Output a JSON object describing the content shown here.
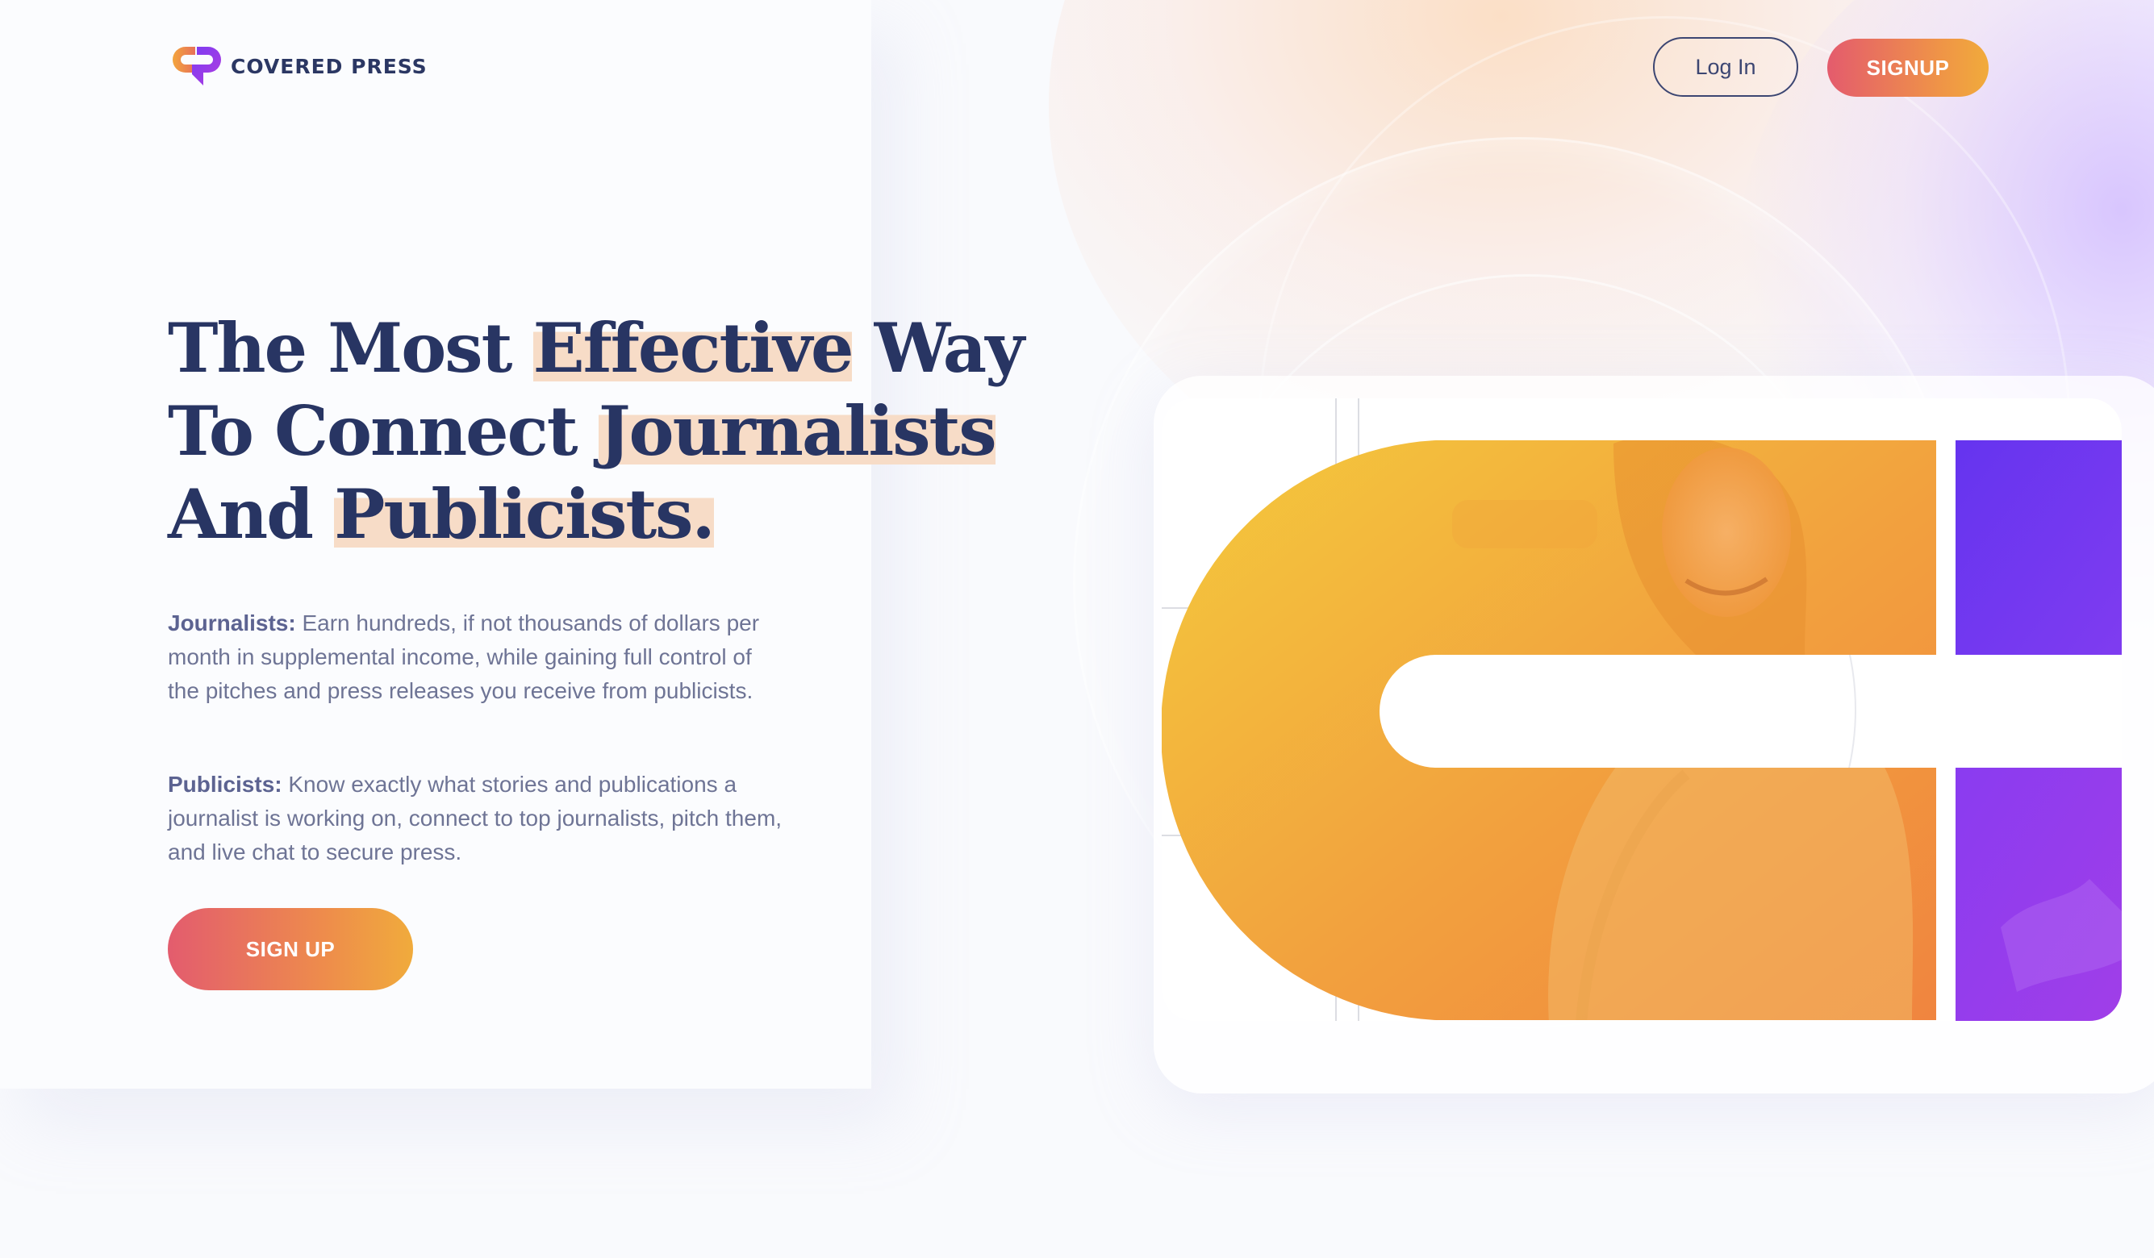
{
  "brand": {
    "name": "COVERED PRESS",
    "logo_icon": "covered-press-logo-icon"
  },
  "nav": {
    "login_label": "Log In",
    "signup_label": "SIGNUP"
  },
  "hero": {
    "headline_lines": [
      {
        "plain": "The Most ",
        "highlight": "Effective",
        "tail": " Way"
      },
      {
        "plain": "To Connect ",
        "highlight": "Journalists",
        "tail": ""
      },
      {
        "plain": "And ",
        "highlight": "Publicists.",
        "tail": ""
      }
    ],
    "journalists_label": "Journalists:",
    "journalists_text": " Earn hundreds, if not thousands of dollars per month in supplemental income, while gaining full control of the pitches and press releases you receive from publicists.",
    "publicists_label": "Publicists:",
    "publicists_text": " Know exactly what stories and publications a journalist is working on, connect to top journalists, pitch them, and live chat to secure press.",
    "cta_label": "SIGN UP"
  },
  "illustration": {
    "icon": "covered-press-c-photo-illustration",
    "colors": {
      "orange_start": "#f2c63a",
      "orange_end": "#f08a3a",
      "purple_start": "#6a36f0",
      "purple_end": "#9b3cf0"
    }
  },
  "colors": {
    "navy": "#283563",
    "highlight": "#f7dcc7",
    "gradient_start": "#e35c6e",
    "gradient_end": "#f0ab3c"
  }
}
